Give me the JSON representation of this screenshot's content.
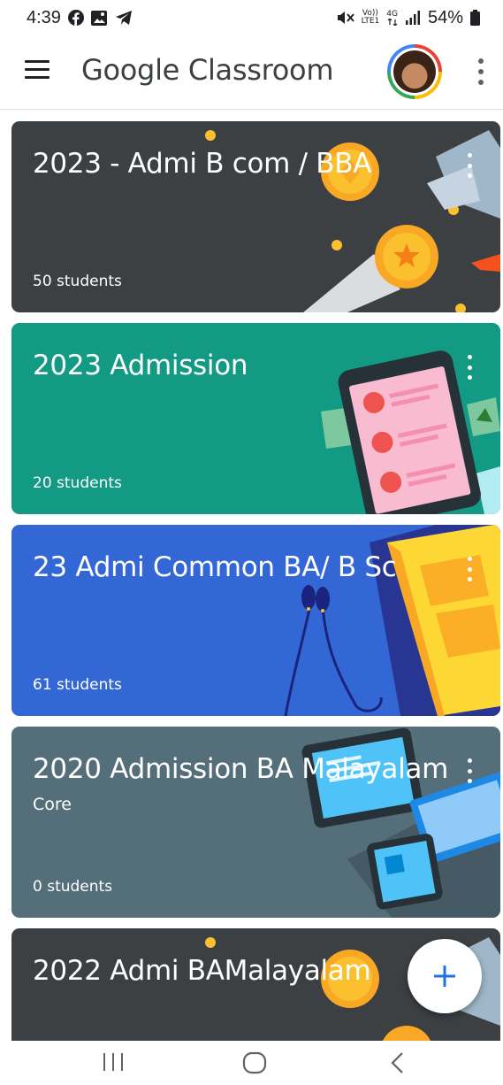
{
  "status_bar": {
    "time": "4:39",
    "net_top": "Vo))",
    "net_bottom": "LTE1",
    "net_gen": "4G",
    "battery": "54%"
  },
  "app_bar": {
    "title": "Google Classroom"
  },
  "classes": [
    {
      "title": "2023 - Admi B com / BBA",
      "section": "",
      "students": "50 students",
      "color": "#3c4043"
    },
    {
      "title": "2023 Admission",
      "section": "",
      "students": "20 students",
      "color": "#129a84"
    },
    {
      "title": "23 Admi Common BA/ B Sc",
      "section": "",
      "students": "61 students",
      "color": "#3367d6"
    },
    {
      "title": "2020 Admission BA Malayalam",
      "section": "Core",
      "students": "0 students",
      "color": "#546e7a"
    },
    {
      "title": "2022 Admi BAMalayalam",
      "section": "",
      "students": "",
      "color": "#3c4043"
    }
  ],
  "icons": {
    "menu": "hamburger-menu-icon",
    "overflow": "more-vert-icon",
    "fab": "plus-icon",
    "nav_recents": "recents-icon",
    "nav_home": "home-icon",
    "nav_back": "back-icon"
  },
  "colors": {
    "accent": "#1a73e8",
    "teal": "#129a84",
    "blue": "#3367d6",
    "slate": "#546e7a",
    "dark": "#3c4043"
  }
}
